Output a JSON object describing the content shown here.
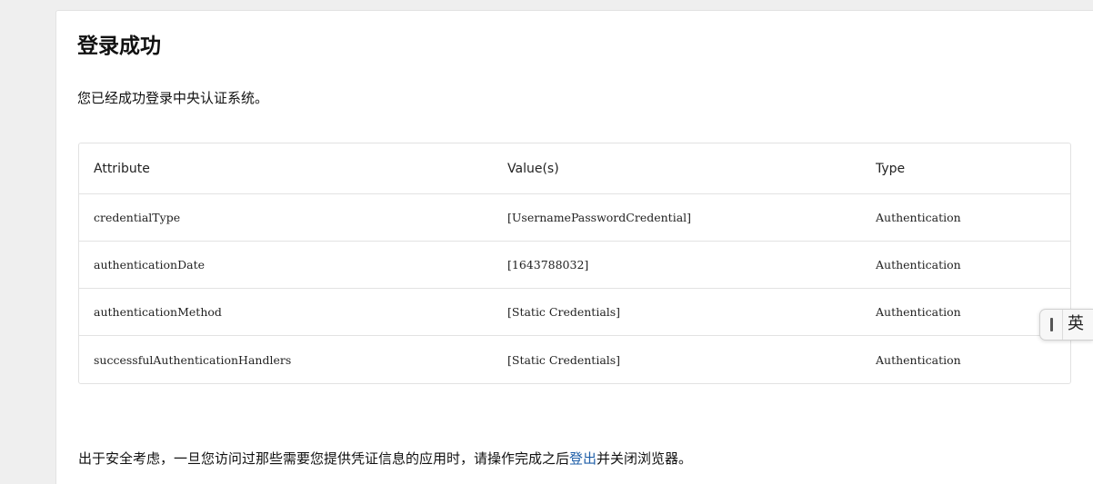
{
  "page": {
    "title": "登录成功",
    "subtitle": "您已经成功登录中央认证系统。"
  },
  "table": {
    "headers": [
      "Attribute",
      "Value(s)",
      "Type"
    ],
    "rows": [
      {
        "attribute": "credentialType",
        "value": "[UsernamePasswordCredential]",
        "type": "Authentication"
      },
      {
        "attribute": "authenticationDate",
        "value": "[1643788032]",
        "type": "Authentication"
      },
      {
        "attribute": "authenticationMethod",
        "value": "[Static Credentials]",
        "type": "Authentication"
      },
      {
        "attribute": "successfulAuthenticationHandlers",
        "value": "[Static Credentials]",
        "type": "Authentication"
      }
    ]
  },
  "footer": {
    "before": "出于安全考虑，一旦您访问过那些需要您提供凭证信息的应用时，请操作完成之后",
    "link": "登出",
    "after": "并关闭浏览器。"
  },
  "ime": {
    "language": "英"
  },
  "colors": {
    "link": "#1f5fa8",
    "background": "#efefef",
    "card": "#ffffff",
    "border": "#e2e2e2"
  }
}
